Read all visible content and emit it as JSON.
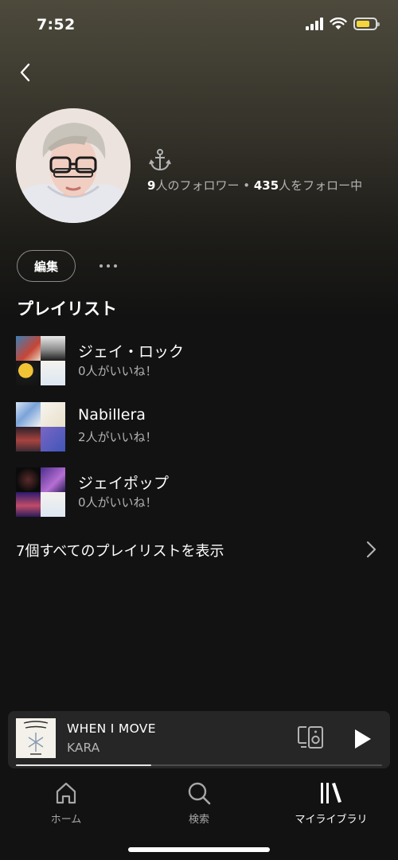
{
  "status_bar": {
    "time": "7:52",
    "icons": [
      "cellular-signal-icon",
      "wifi-icon",
      "battery-icon"
    ],
    "battery_color": "#f4d63c"
  },
  "header": {
    "back_icon": "chevron-left-icon"
  },
  "profile": {
    "badge_icon": "anchor-icon",
    "followers_count": "9",
    "followers_label": "人のフォロワー",
    "separator": " • ",
    "following_count": "435",
    "following_label": "人をフォロー中",
    "edit_label": "編集",
    "more_icon": "more-horizontal-icon"
  },
  "playlists": {
    "section_title": "プレイリスト",
    "items": [
      {
        "title": "ジェイ・ロック",
        "subtitle": "0人がいいね！"
      },
      {
        "title": "Nabillera",
        "subtitle": "2人がいいね！"
      },
      {
        "title": "ジェイポップ",
        "subtitle": "0人がいいね！"
      }
    ],
    "show_all_label": "7個すべてのプレイリストを表示"
  },
  "now_playing": {
    "title": "WHEN I MOVE",
    "artist": "KARA",
    "progress": 0.37,
    "devices_icon": "connect-device-icon",
    "play_icon": "play-icon"
  },
  "tab_bar": {
    "tabs": [
      {
        "label": "ホーム",
        "icon": "home-icon",
        "active": false
      },
      {
        "label": "検索",
        "icon": "search-icon",
        "active": false
      },
      {
        "label": "マイライブラリ",
        "icon": "library-icon",
        "active": true
      }
    ]
  },
  "colors": {
    "background": "#121212",
    "header_tint": "#4d4a3c",
    "secondary_text": "#b3b3b3",
    "mini_player_bg": "#262626"
  }
}
